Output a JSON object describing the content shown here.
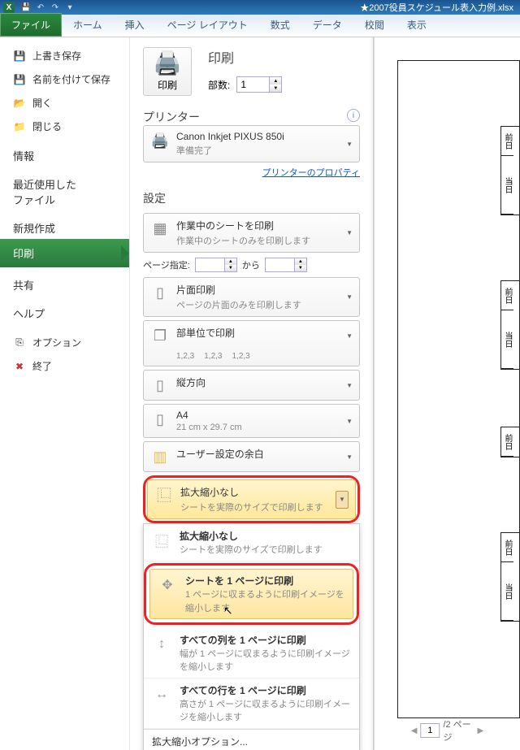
{
  "titlebar": {
    "doc_title": "★2007役員スケジュール表入力例.xlsx",
    "app_letter": "X"
  },
  "tabs": {
    "file": "ファイル",
    "home": "ホーム",
    "insert": "挿入",
    "layout": "ページ レイアウト",
    "formula": "数式",
    "data": "データ",
    "review": "校閲",
    "view": "表示"
  },
  "nav": {
    "save": "上書き保存",
    "saveas": "名前を付けて保存",
    "open": "開く",
    "close": "閉じる",
    "info": "情報",
    "recent_l1": "最近使用した",
    "recent_l2": "ファイル",
    "new": "新規作成",
    "print": "印刷",
    "share": "共有",
    "help": "ヘルプ",
    "options": "オプション",
    "exit": "終了"
  },
  "print": {
    "heading": "印刷",
    "btn": "印刷",
    "copies_label": "部数:",
    "copies_value": "1",
    "printer_heading": "プリンター",
    "printer_name": "Canon Inkjet PIXUS 850i",
    "printer_status": "準備完了",
    "printer_props": "プリンターのプロパティ",
    "settings_heading": "設定",
    "sheet_title": "作業中のシートを印刷",
    "sheet_sub": "作業中のシートのみを印刷します",
    "pages_label": "ページ指定:",
    "pages_to": "から",
    "side_title": "片面印刷",
    "side_sub": "ページの片面のみを印刷します",
    "collate_title": "部単位で印刷",
    "collate_a": "1,2,3",
    "collate_b": "1,2,3",
    "collate_c": "1,2,3",
    "orient": "縦方向",
    "paper": "A4",
    "paper_sub": "21 cm x 29.7 cm",
    "margins": "ユーザー設定の余白",
    "scale_title": "拡大縮小なし",
    "scale_sub": "シートを実際のサイズで印刷します",
    "opt_noscale_title": "拡大縮小なし",
    "opt_noscale_sub": "シートを実際のサイズで印刷します",
    "opt_fit_title": "シートを 1 ページに印刷",
    "opt_fit_sub": "1 ページに収まるように印刷イメージを縮小します",
    "opt_cols_title": "すべての列を 1 ページに印刷",
    "opt_cols_sub": "幅が 1 ページに収まるように印刷イメージを縮小します",
    "opt_rows_title": "すべての行を 1 ページに印刷",
    "opt_rows_sub": "高さが 1 ページに収まるように印刷イメージを縮小します",
    "scale_options": "拡大縮小オプション..."
  },
  "preview": {
    "cells": [
      "前日",
      "当日",
      "前日",
      "当日",
      "前日",
      "前日",
      "当日"
    ],
    "current_page": "1",
    "total": "/2 ページ"
  }
}
